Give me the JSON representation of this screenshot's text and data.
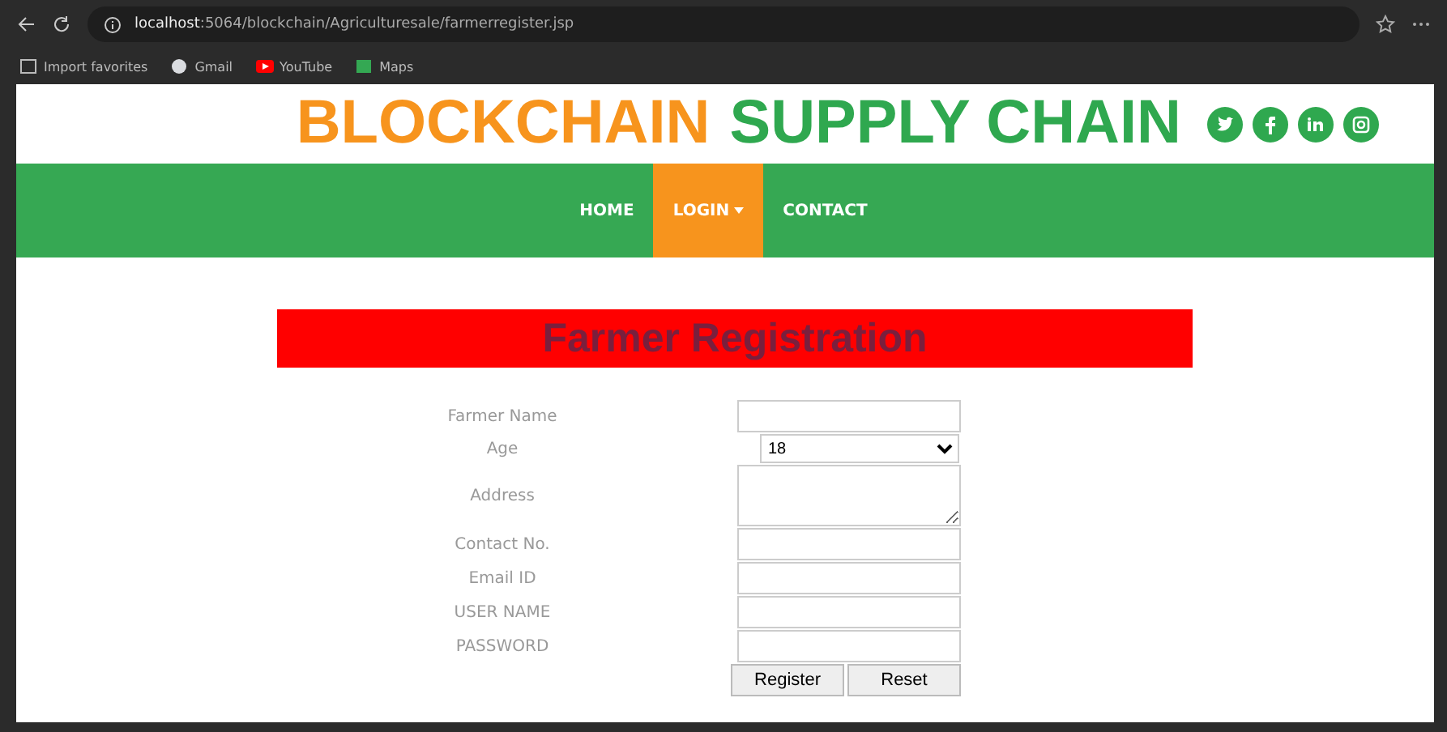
{
  "browser": {
    "url_host": "localhost",
    "url_path": ":5064/blockchain/Agriculturesale/farmerregister.jsp",
    "bookmarks": [
      {
        "label": "Import favorites",
        "kind": "folder"
      },
      {
        "label": "Gmail",
        "kind": "gmail"
      },
      {
        "label": "YouTube",
        "kind": "youtube"
      },
      {
        "label": "Maps",
        "kind": "maps"
      }
    ]
  },
  "header": {
    "title_accent": "BLOCKCHAIN",
    "title_rest": "SUPPLY CHAIN",
    "social": [
      {
        "kind": "twitter"
      },
      {
        "kind": "facebook"
      },
      {
        "kind": "linkedin"
      },
      {
        "kind": "instagram"
      }
    ]
  },
  "nav": [
    {
      "label": "HOME",
      "selected": false,
      "dropdown": false
    },
    {
      "label": "LOGIN",
      "selected": true,
      "dropdown": true
    },
    {
      "label": "CONTACT",
      "selected": false,
      "dropdown": false
    }
  ],
  "form": {
    "title": "Farmer Registration",
    "fields": [
      {
        "label": "Farmer Name",
        "kind": "input"
      },
      {
        "label": "Age",
        "kind": "select",
        "value": "18"
      },
      {
        "label": "Address",
        "kind": "textarea"
      },
      {
        "label": "Contact No.",
        "kind": "input"
      },
      {
        "label": "Email ID",
        "kind": "input"
      },
      {
        "label": "USER NAME",
        "kind": "input"
      },
      {
        "label": "PASSWORD",
        "kind": "input"
      }
    ],
    "buttons": [
      "Register",
      "Reset"
    ]
  }
}
